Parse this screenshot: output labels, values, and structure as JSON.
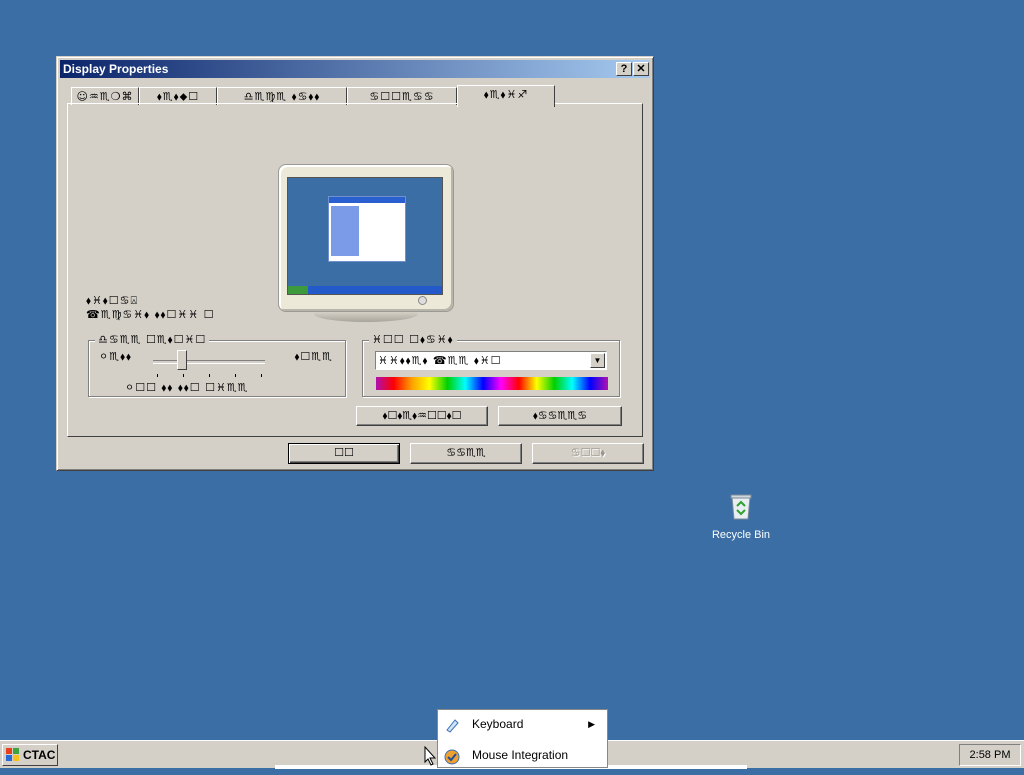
{
  "window": {
    "title": "Display Properties",
    "help_label": "?",
    "close_label": "✕",
    "tabs": [
      {
        "label": "☺♒︎♏︎❍︎⌘"
      },
      {
        "label": "⬧︎♏︎⬧︎⬥︎☐︎"
      },
      {
        "label": "♎︎♏︎♍︎♏︎ ⬧︎♋︎⬧︎⬧︎"
      },
      {
        "label": "♋︎☐︎☐︎♏︎♋︎♋︎"
      },
      {
        "label": "⬧︎♏︎⬧︎♓︎♐︎"
      }
    ],
    "display_label": "⬧︎♓︎⬧︎☐︎♋︎⍓︎",
    "display_value": "☎︎♏︎♍︎♋︎♓︎⬧︎ ⬧︎⬧︎☐︎♓︎♓︎ ☐︎",
    "resolution_group": "♎︎♋︎♏︎♏︎ ☐︎♏︎⬧︎☐︎♓︎☐︎",
    "less_label": "⚪︎♏︎⬧︎⬧︎",
    "more_label": "⬧︎☐︎♏︎♏︎",
    "resolution_value": "⚪︎☐︎☐︎ ⬧︎⬧︎ ⬧︎⬧︎☐︎ ☐︎♓︎♏︎♏︎",
    "color_group": "♓︎☐︎☐︎ ☐︎⬧︎♋︎♓︎⬧︎",
    "color_value": "♓︎♓︎⬧︎⬧︎♏︎⬧︎ ☎︎♏︎♏︎ ⬧︎♓︎☐︎",
    "troubleshoot_label": "⬧︎☐︎⬧︎♏︎⬧︎♒︎☐︎☐︎⬧︎☐︎",
    "advanced_label": "⬧︎♋︎♋︎♏︎♏︎♋︎",
    "ok_label": "☐︎☐︎",
    "cancel_label": "♋︎♋︎♏︎♏︎",
    "apply_label": "♋︎☐︎☐︎⬧︎"
  },
  "desktop": {
    "recycle_bin_label": "Recycle Bin"
  },
  "taskbar": {
    "start_label": "CTAC",
    "clock": "2:58 PM"
  },
  "context_menu": {
    "items": [
      {
        "label": "Keyboard",
        "has_submenu": true,
        "icon": "keyboard-icon"
      },
      {
        "label": "Mouse Integration",
        "has_submenu": false,
        "icon": "mouse-integration-icon"
      }
    ]
  }
}
